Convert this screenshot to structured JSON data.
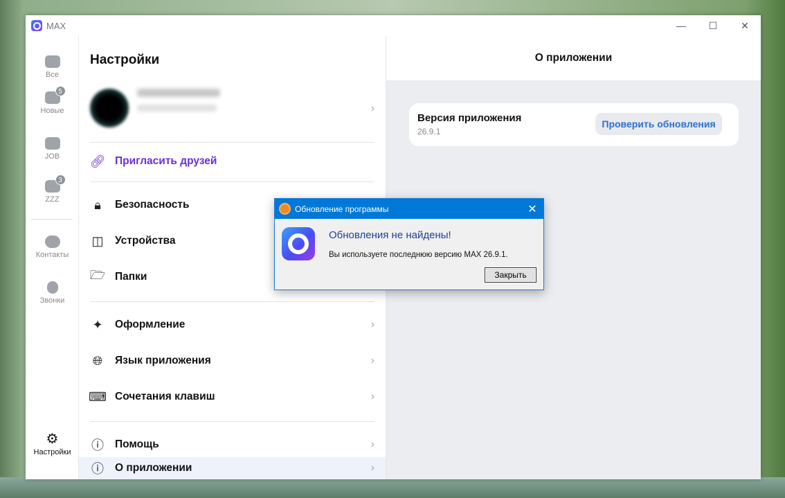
{
  "window": {
    "title": "MAX"
  },
  "rail": [
    {
      "label": "Все",
      "icon": "chat-icon"
    },
    {
      "label": "Новые",
      "icon": "folder-icon",
      "badge": "5"
    },
    {
      "label": "JOB",
      "icon": "folder-icon"
    },
    {
      "label": "ZZZ",
      "icon": "folder-icon",
      "badge": "3"
    },
    {
      "label": "Контакты",
      "icon": "contacts-icon"
    },
    {
      "label": "Звонки",
      "icon": "phone-icon"
    },
    {
      "label": "Настройки",
      "icon": "gear-icon"
    }
  ],
  "settings": {
    "title": "Настройки",
    "invite": "Пригласить друзей",
    "items": [
      "Безопасность",
      "Устройства",
      "Папки",
      "Оформление",
      "Язык приложения",
      "Сочетания клавиш",
      "Помощь",
      "О приложении"
    ]
  },
  "about": {
    "title": "О приложении",
    "version_label": "Версия приложения",
    "version": "26.9.1",
    "check_button": "Проверить обновления"
  },
  "dialog": {
    "title": "Обновление программы",
    "heading": "Обновления не найдены!",
    "message": "Вы используете последнюю версию MAX 26.9.1.",
    "close_button": "Закрыть"
  },
  "colors": {
    "accent": "#6a2fd6",
    "link": "#2a71d0",
    "dialog_title": "#0078d7"
  }
}
